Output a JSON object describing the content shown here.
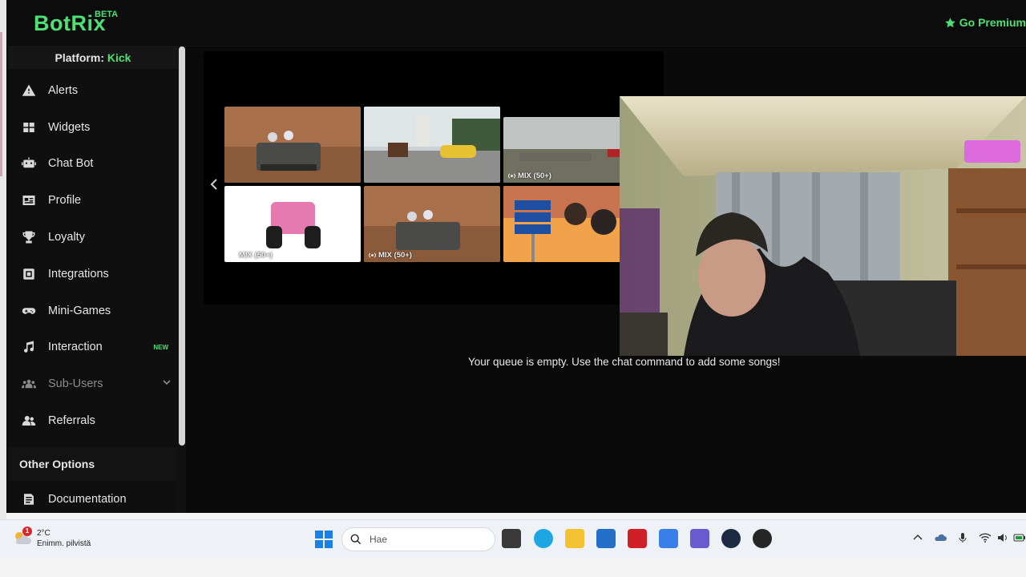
{
  "app": {
    "logo": "BotRix",
    "beta": "BETA",
    "premium_label": "Go Premium"
  },
  "sidebar": {
    "platform_prefix": "Platform:",
    "platform_name": "Kick",
    "items": [
      {
        "label": "Alerts",
        "icon": "alert-triangle-icon"
      },
      {
        "label": "Widgets",
        "icon": "widgets-grid-icon"
      },
      {
        "label": "Chat Bot",
        "icon": "robot-icon"
      },
      {
        "label": "Profile",
        "icon": "id-card-icon"
      },
      {
        "label": "Loyalty",
        "icon": "trophy-icon"
      },
      {
        "label": "Integrations",
        "icon": "integrations-icon"
      },
      {
        "label": "Mini-Games",
        "icon": "gamepad-icon"
      },
      {
        "label": "Interaction",
        "icon": "music-note-icon",
        "badge": "NEW"
      },
      {
        "label": "Sub-Users",
        "icon": "users-icon"
      },
      {
        "label": "Referrals",
        "icon": "user-group-icon"
      }
    ],
    "other_options": "Other Options",
    "documentation": "Documentation"
  },
  "main": {
    "thumb_label": "MIX (50+)",
    "queue_empty": "Your queue is empty. Use the chat command to add some songs!"
  },
  "taskbar": {
    "temperature": "2°C",
    "weather_desc": "Enimm. pilvistä",
    "weather_badge": "1",
    "search_placeholder": "Hae"
  },
  "colors": {
    "accent": "#4ee074",
    "background": "#0a0a0a"
  }
}
